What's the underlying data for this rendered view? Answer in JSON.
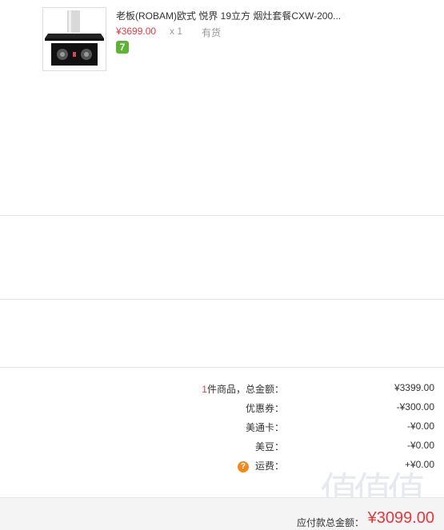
{
  "product": {
    "title": "老板(ROBAM)欧式 悦界 19立方 烟灶套餐CXW-200...",
    "price": "¥3699.00",
    "qty": "x 1",
    "stock": "有货",
    "badge": "7"
  },
  "summary": {
    "count_prefix": "1",
    "count_suffix": "件商品，总金额：",
    "total_goods": "¥3399.00",
    "coupon_label": "优惠券：",
    "coupon_val": "-¥300.00",
    "meitong_label": "美通卡：",
    "meitong_val": "-¥0.00",
    "meidou_label": "美豆：",
    "meidou_val": "-¥0.00",
    "shipping_icon": "?",
    "shipping_label": "运费：",
    "shipping_val": "+¥0.00"
  },
  "footer": {
    "payable_label": "应付款总金额：",
    "payable_val": "¥3099.00"
  },
  "watermark": {
    "text": "值值值"
  },
  "colors": {
    "accent": "#e4393c",
    "badge": "#5cb531",
    "help": "#f08a1d"
  }
}
